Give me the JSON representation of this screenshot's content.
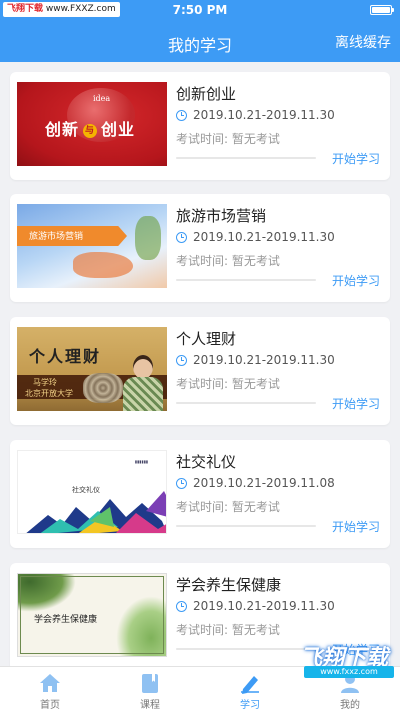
{
  "status_bar": {
    "time": "7:50 PM",
    "watermark": {
      "brand": "飞翔下载",
      "url": "www.FXXZ.com"
    }
  },
  "header": {
    "title": "我的学习",
    "offline_label": "离线缓存"
  },
  "courses": [
    {
      "title": "创新创业",
      "date": "2019.10.21-2019.11.30",
      "exam": "考试时间:  暂无考试",
      "progress": 0,
      "action": "开始学习",
      "thumb": {
        "heading": "创新",
        "joiner": "与",
        "tail": "创业",
        "word": "idea"
      }
    },
    {
      "title": "旅游市场营销",
      "date": "2019.10.21-2019.11.30",
      "exam": "考试时间:  暂无考试",
      "progress": 0,
      "action": "开始学习",
      "thumb": {
        "heading": "旅游市场营销"
      }
    },
    {
      "title": "个人理财",
      "date": "2019.10.21-2019.11.30",
      "exam": "考试时间:  暂无考试",
      "progress": 0,
      "action": "开始学习",
      "thumb": {
        "heading": "个人理财",
        "name": "马学玲",
        "org": "北京开放大学"
      }
    },
    {
      "title": "社交礼仪",
      "date": "2019.10.21-2019.11.08",
      "exam": "考试时间:  暂无考试",
      "progress": 0,
      "action": "开始学习",
      "thumb": {
        "heading": "社交礼仪"
      }
    },
    {
      "title": "学会养生保健康",
      "date": "2019.10.21-2019.11.30",
      "exam": "考试时间:  暂无考试",
      "progress": 0,
      "action": "开始学习",
      "thumb": {
        "heading": "学会养生保健康"
      }
    }
  ],
  "tabbar": {
    "tabs": [
      {
        "label": "首页",
        "icon": "home-icon"
      },
      {
        "label": "课程",
        "icon": "book-icon"
      },
      {
        "label": "学习",
        "icon": "pencil-icon",
        "active": true
      },
      {
        "label": "我的",
        "icon": "user-icon"
      }
    ]
  },
  "watermark_bottom": {
    "logo": "飞翔下载",
    "url": "www.fxxz.com"
  },
  "colors": {
    "primary": "#3d9bf5",
    "background": "#f0f1f4"
  }
}
